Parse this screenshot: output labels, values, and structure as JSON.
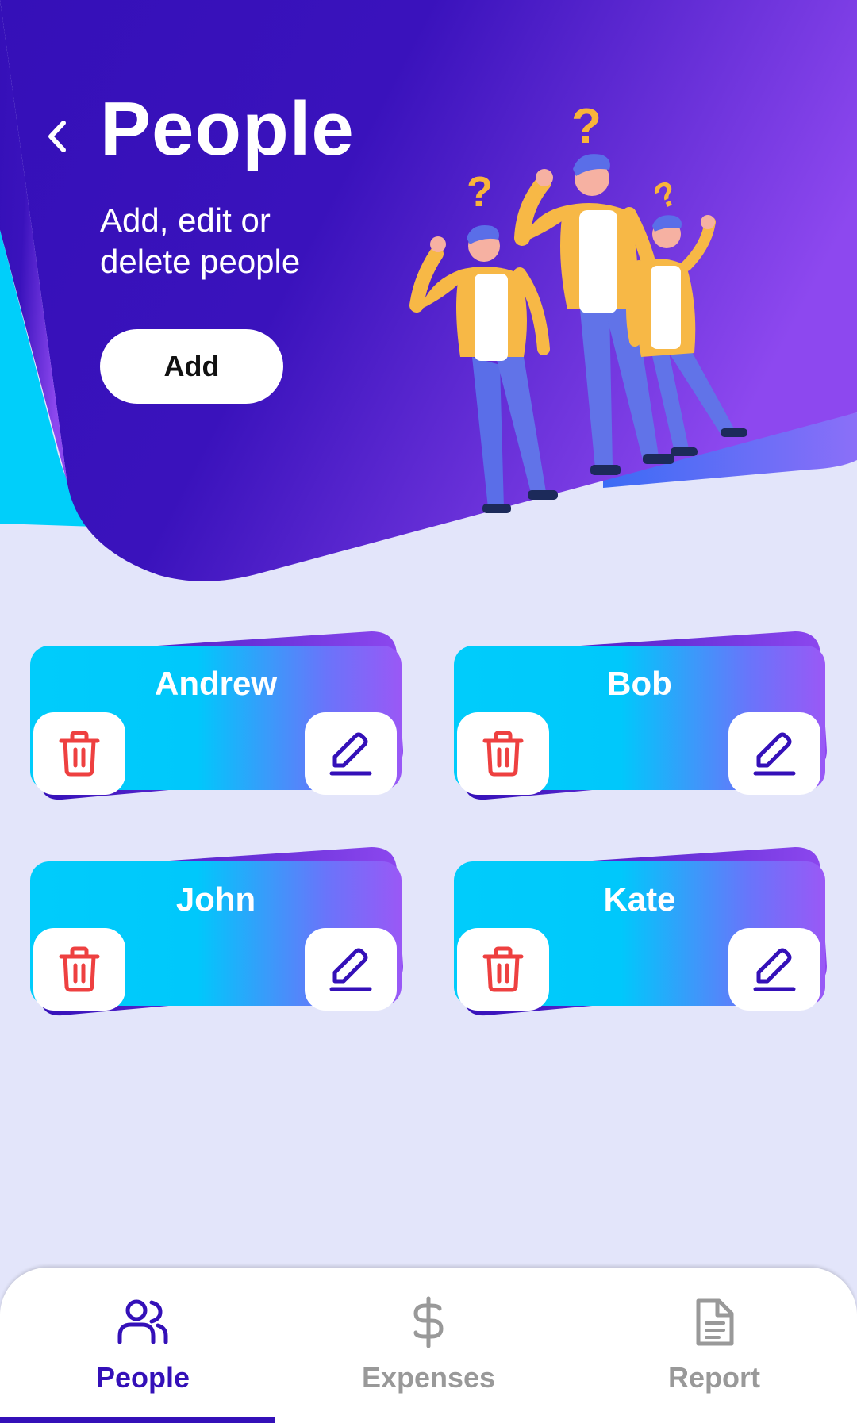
{
  "header": {
    "title": "People",
    "subtitle": "Add, edit or delete people",
    "add_label": "Add"
  },
  "people": [
    {
      "name": "Andrew"
    },
    {
      "name": "Bob"
    },
    {
      "name": "John"
    },
    {
      "name": "Kate"
    }
  ],
  "nav": {
    "items": [
      {
        "label": "People",
        "icon": "people-icon",
        "active": true
      },
      {
        "label": "Expenses",
        "icon": "dollar-icon",
        "active": false
      },
      {
        "label": "Report",
        "icon": "report-document-icon",
        "active": false
      }
    ]
  },
  "colors": {
    "primary": "#3410b8",
    "header_gradient_end": "#8c48ee",
    "accent_cyan": "#00cffa",
    "delete_red": "#ee4040",
    "background": "#e3e5fa",
    "card_gradient_start": "#00ccfb",
    "card_gradient_end": "#9a58f6"
  }
}
